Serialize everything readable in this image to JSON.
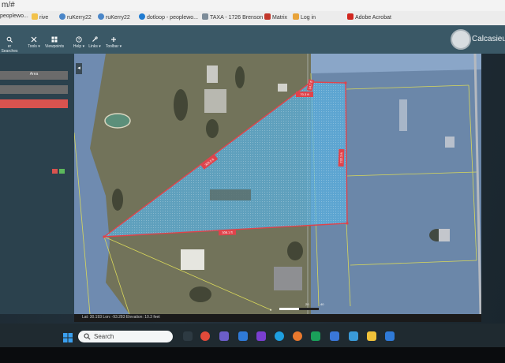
{
  "browser": {
    "url": "m/#",
    "bookmarks": [
      "peoplewo...",
      "rive",
      "ruKerry22",
      "ruKerry22",
      "dotloop - peoplewo...",
      "TAXA - 1726 Brenson",
      "Matrix",
      "Log in",
      "Adobe Acrobat"
    ]
  },
  "app": {
    "brand": "Calcasieu Pa",
    "tools": [
      "er Searches",
      "Tools",
      "Viewpoints",
      "Help",
      "Links",
      "Toolbar"
    ]
  },
  "panel": {
    "field_label": "Area"
  },
  "map": {
    "measurements": {
      "west_edge": "329.5 ft",
      "north_edge": "70.3 ft",
      "north_corner": "14.7 ft",
      "east_edge": "232.3 ft",
      "south_edge": "306.1 ft"
    },
    "scale_label": "ft",
    "scale_values": [
      "20",
      "40"
    ]
  },
  "status": {
    "text": "Lat: 30.193   Lon: -93.283   Elevation: 10.3 feet"
  },
  "taskbar": {
    "search_placeholder": "Search"
  },
  "colors": {
    "header": "#3a5866",
    "panel": "#2b414d",
    "parcel_fill": "#4bb3e6",
    "parcel_outline": "#e0434b",
    "parcel_lines": "#d9d85a"
  }
}
